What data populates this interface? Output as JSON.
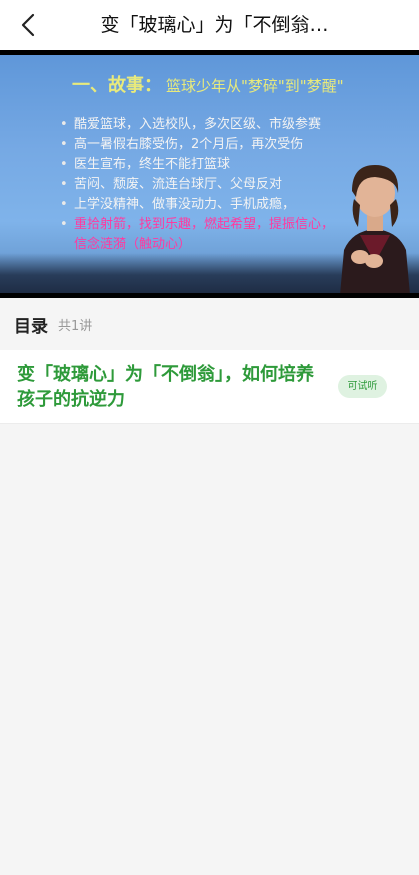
{
  "header": {
    "title": "变「玻璃心」为「不倒翁…"
  },
  "video": {
    "slide_heading": "一、故事：",
    "slide_heading_rest": "篮球少年从\"梦碎\"到\"梦醒\"",
    "bullets": [
      "酷爱篮球，入选校队，多次区级、市级参赛",
      "高一暑假右膝受伤，2个月后，再次受伤",
      "医生宣布，终生不能打篮球",
      "苦闷、颓废、流连台球厅、父母反对",
      "上学没精神、做事没动力、手机成瘾，"
    ],
    "highlight_line1": "重拾射箭，找到乐趣，燃起希望，提振信心，",
    "highlight_line2": "信念涟漪（触动心）"
  },
  "catalog": {
    "title": "目录",
    "count": "共1讲"
  },
  "lessons": [
    {
      "title": "变「玻璃心」为「不倒翁」，如何培养孩子的抗逆力",
      "badge": "可试听"
    }
  ],
  "colors": {
    "accent": "#2e9a3a",
    "badge_bg": "#dff2e1",
    "slide_bg": "#6fa3e0"
  }
}
